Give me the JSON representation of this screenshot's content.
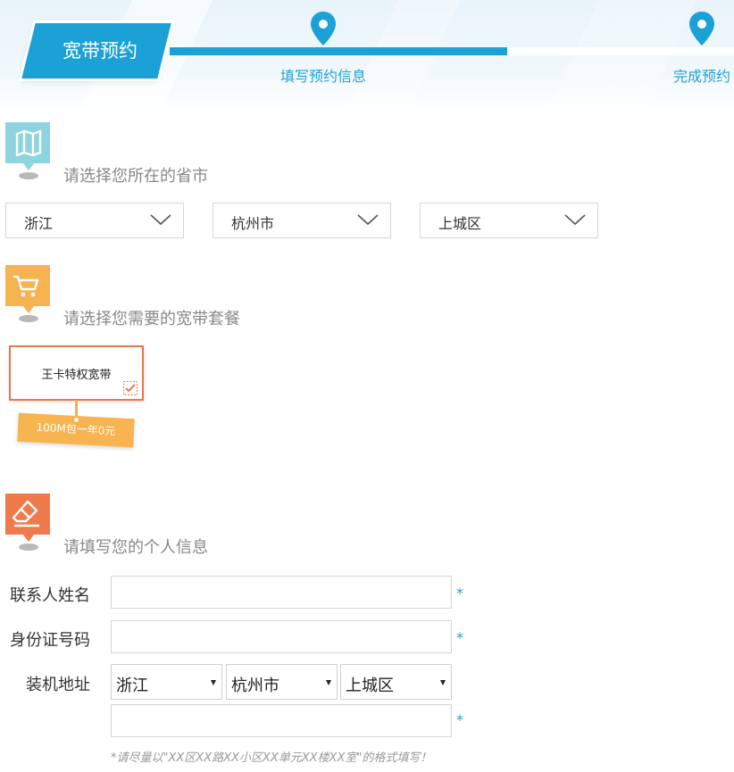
{
  "header": {
    "banner": "宽带预约",
    "steps": [
      {
        "label": "填写预约信息",
        "active": true
      },
      {
        "label": "完成预约",
        "active": false
      }
    ],
    "progress_fraction": 0.6,
    "accent_color": "#1ba1d6"
  },
  "region_section": {
    "title": "请选择您所在的省市",
    "icon": "map-icon",
    "province": "浙江",
    "city": "杭州市",
    "district": "上城区"
  },
  "package_section": {
    "title": "请选择您需要的宽带套餐",
    "icon": "cart-icon",
    "package_name": "王卡特权宽带",
    "package_tag": "100M包一年0元",
    "selected": true
  },
  "info_section": {
    "title": "请填写您的个人信息",
    "icon": "eraser-icon",
    "contact_label": "联系人姓名",
    "contact_value": "",
    "id_label": "身份证号码",
    "id_value": "",
    "address_label": "装机地址",
    "address_province": "浙江",
    "address_city": "杭州市",
    "address_district": "上城区",
    "address_detail": "",
    "required_mark": "*",
    "hint": "*请尽量以\"XX区XX路XX小区XX单元XX楼XX室\"的格式填写！"
  }
}
